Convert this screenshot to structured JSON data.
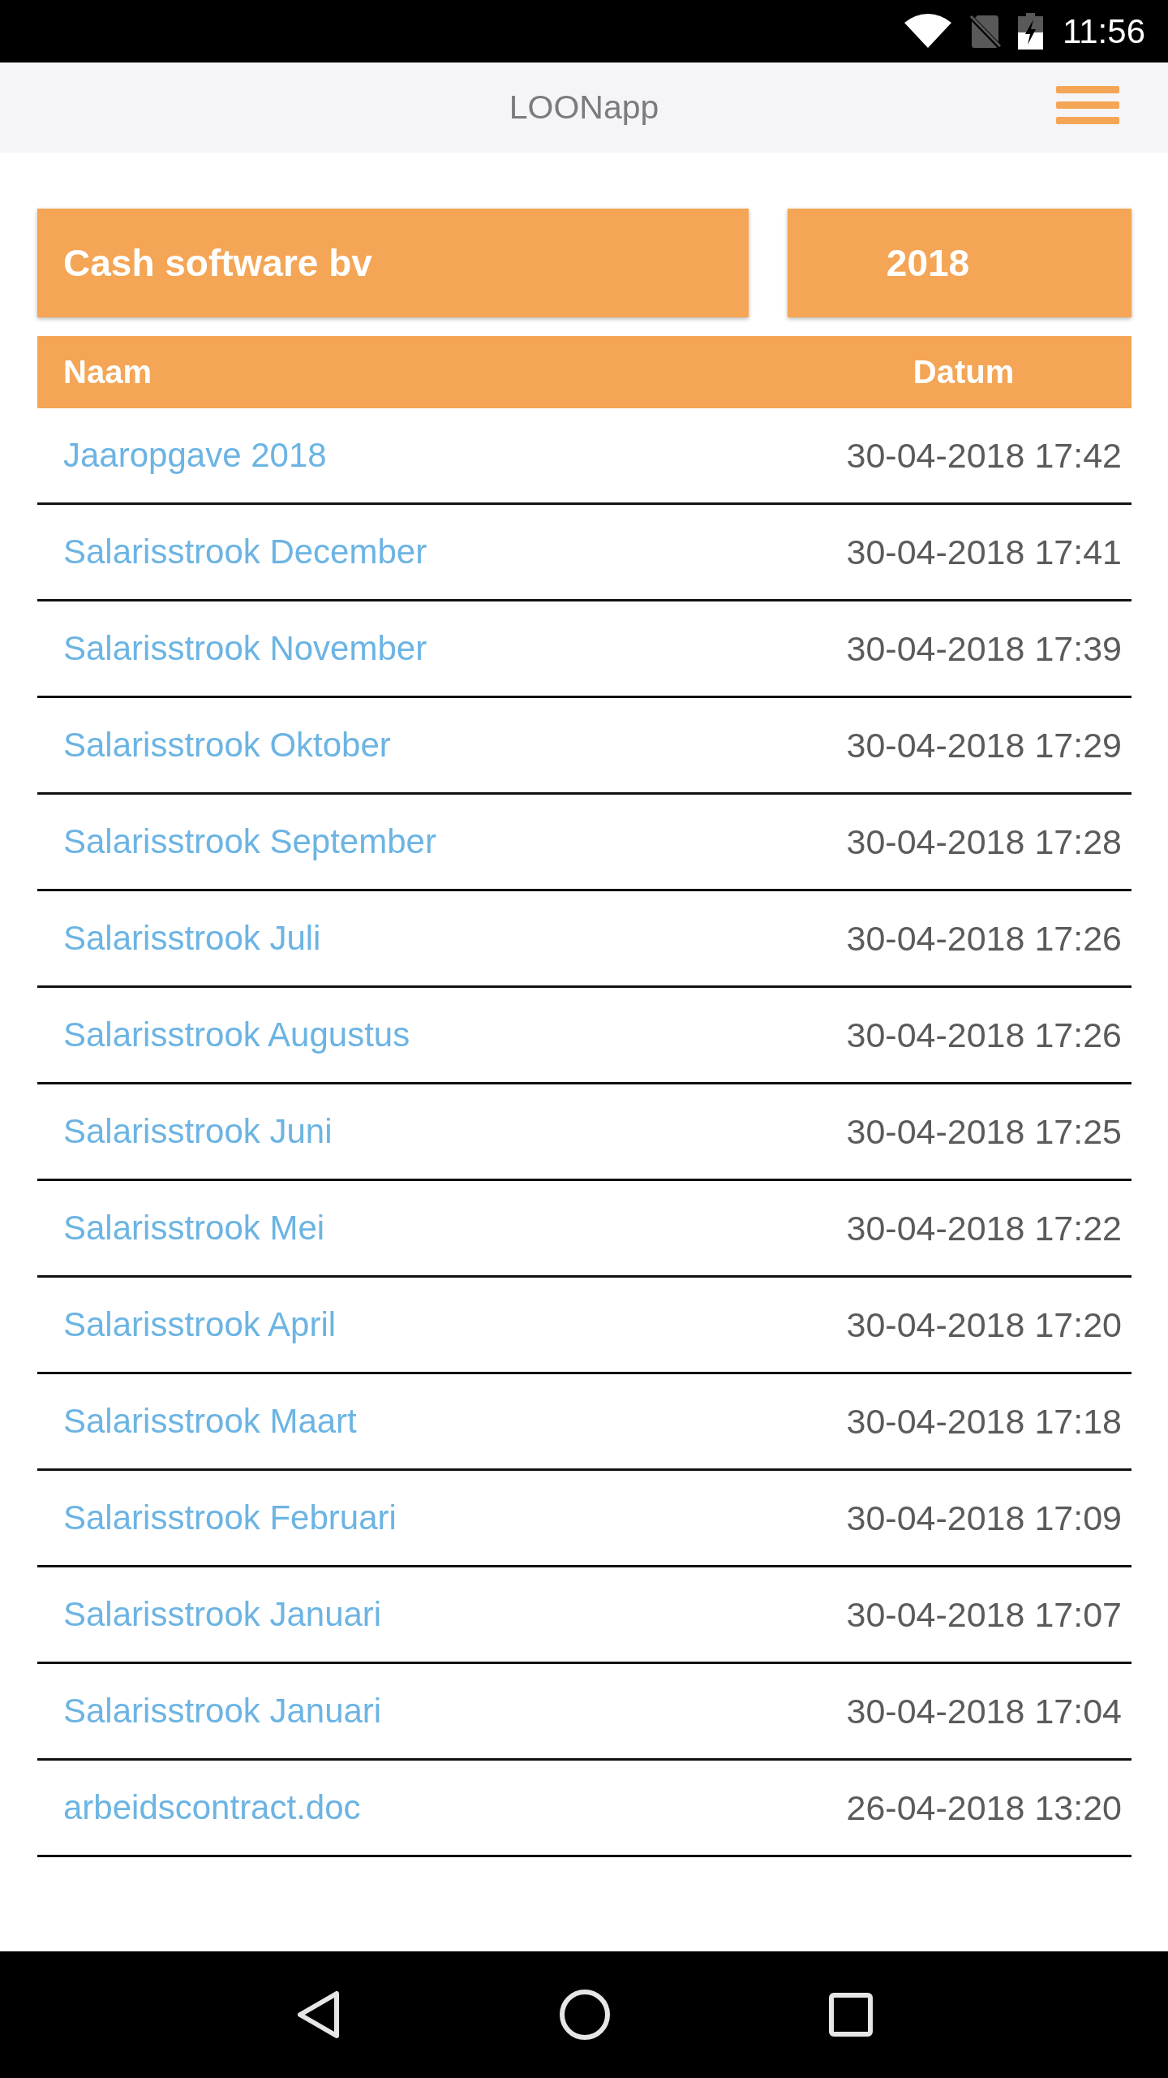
{
  "status_bar": {
    "time": "11:56"
  },
  "app_bar": {
    "title": "LOONapp"
  },
  "selectors": {
    "company": "Cash software bv",
    "year": "2018"
  },
  "table": {
    "columns": [
      "Naam",
      "Datum"
    ],
    "rows": [
      {
        "name": "Jaaropgave 2018",
        "date": "30-04-2018 17:42"
      },
      {
        "name": "Salarisstrook December",
        "date": "30-04-2018 17:41"
      },
      {
        "name": "Salarisstrook November",
        "date": "30-04-2018 17:39"
      },
      {
        "name": "Salarisstrook Oktober",
        "date": "30-04-2018 17:29"
      },
      {
        "name": "Salarisstrook September",
        "date": "30-04-2018 17:28"
      },
      {
        "name": "Salarisstrook Juli",
        "date": "30-04-2018 17:26"
      },
      {
        "name": "Salarisstrook Augustus",
        "date": "30-04-2018 17:26"
      },
      {
        "name": "Salarisstrook Juni",
        "date": "30-04-2018 17:25"
      },
      {
        "name": "Salarisstrook Mei",
        "date": "30-04-2018 17:22"
      },
      {
        "name": "Salarisstrook April",
        "date": "30-04-2018 17:20"
      },
      {
        "name": "Salarisstrook Maart",
        "date": "30-04-2018 17:18"
      },
      {
        "name": "Salarisstrook Februari",
        "date": "30-04-2018 17:09"
      },
      {
        "name": "Salarisstrook Januari",
        "date": "30-04-2018 17:07"
      },
      {
        "name": "Salarisstrook Januari",
        "date": "30-04-2018 17:04"
      },
      {
        "name": "arbeidscontract.doc",
        "date": "26-04-2018 13:20"
      }
    ]
  }
}
